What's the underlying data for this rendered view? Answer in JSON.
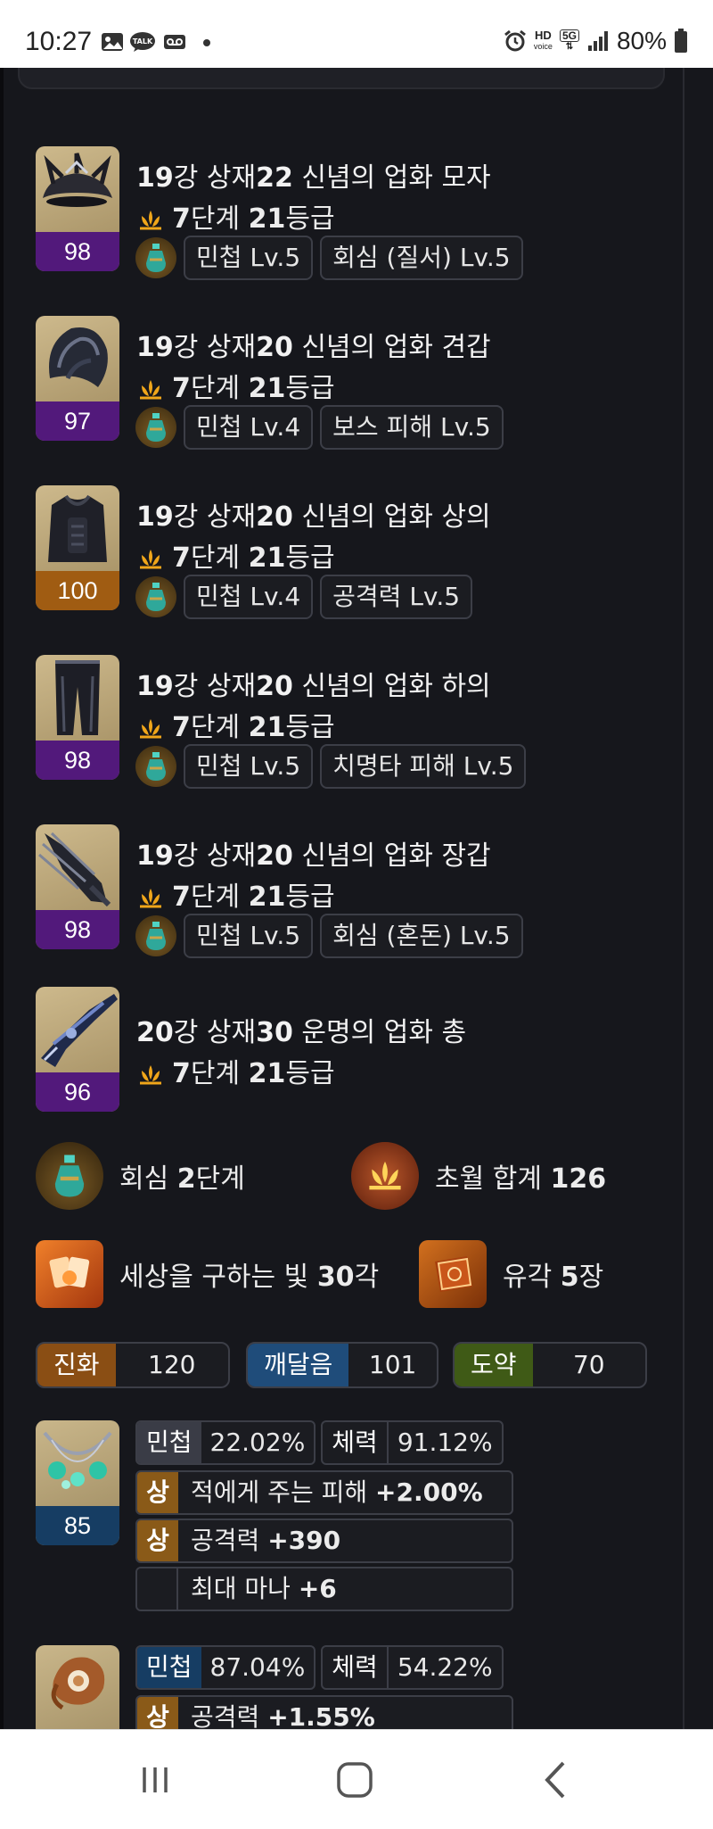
{
  "status_bar": {
    "time": "10:27",
    "notification_icons": [
      "gallery-icon",
      "talk-icon",
      "voicemail-icon",
      "dot-icon"
    ],
    "hd_label": "HD",
    "voice_label": "voice",
    "network_label": "5G",
    "battery": "80%"
  },
  "equipment": [
    {
      "name_pre": "19",
      "name_mid": "강 상재",
      "name_num": "22",
      "name_post": " 신념의 업화 모자",
      "quality": "98",
      "quality_color": "#52197b",
      "tr_stage": "7",
      "tr_stage_label": "단계 ",
      "tr_grade": "21",
      "tr_grade_label": "등급",
      "elixirs": [
        "민첩 Lv.5",
        "회심 (질서) Lv.5"
      ],
      "icon": "helmet-icon"
    },
    {
      "name_pre": "19",
      "name_mid": "강 상재",
      "name_num": "20",
      "name_post": " 신념의 업화 견갑",
      "quality": "97",
      "quality_color": "#52197b",
      "tr_stage": "7",
      "tr_stage_label": "단계 ",
      "tr_grade": "21",
      "tr_grade_label": "등급",
      "elixirs": [
        "민첩 Lv.4",
        "보스 피해 Lv.5"
      ],
      "icon": "shoulder-icon"
    },
    {
      "name_pre": "19",
      "name_mid": "강 상재",
      "name_num": "20",
      "name_post": " 신념의 업화 상의",
      "quality": "100",
      "quality_color": "#a05c12",
      "tr_stage": "7",
      "tr_stage_label": "단계 ",
      "tr_grade": "21",
      "tr_grade_label": "등급",
      "elixirs": [
        "민첩 Lv.4",
        "공격력 Lv.5"
      ],
      "icon": "chest-icon"
    },
    {
      "name_pre": "19",
      "name_mid": "강 상재",
      "name_num": "20",
      "name_post": " 신념의 업화 하의",
      "quality": "98",
      "quality_color": "#52197b",
      "tr_stage": "7",
      "tr_stage_label": "단계 ",
      "tr_grade": "21",
      "tr_grade_label": "등급",
      "elixirs": [
        "민첩 Lv.5",
        "치명타 피해 Lv.5"
      ],
      "icon": "pants-icon"
    },
    {
      "name_pre": "19",
      "name_mid": "강 상재",
      "name_num": "20",
      "name_post": " 신념의 업화 장갑",
      "quality": "98",
      "quality_color": "#52197b",
      "tr_stage": "7",
      "tr_stage_label": "단계 ",
      "tr_grade": "21",
      "tr_grade_label": "등급",
      "elixirs": [
        "민첩 Lv.5",
        "회심 (혼돈) Lv.5"
      ],
      "icon": "gloves-icon"
    },
    {
      "name_pre": "20",
      "name_mid": "강 상재",
      "name_num": "30",
      "name_post": " 운명의 업화 총",
      "quality": "96",
      "quality_color": "#52197b",
      "tr_stage": "7",
      "tr_stage_label": "단계 ",
      "tr_grade": "21",
      "tr_grade_label": "등급",
      "elixirs": [],
      "icon": "gun-icon"
    }
  ],
  "summary": {
    "elixir_label": "회심 ",
    "elixir_num": "2",
    "elixir_suffix": "단계",
    "transcend_label": "초월 합계 ",
    "transcend_total": "126",
    "light_label": "세상을 구하는 빛 ",
    "light_num": "30",
    "light_suffix": "각",
    "relic_label": "유각 ",
    "relic_num": "5",
    "relic_suffix": "장"
  },
  "ark_passive": [
    {
      "name": "진화",
      "value": "120",
      "color": "#8a4e14"
    },
    {
      "name": "깨달음",
      "value": "101",
      "color": "#1f4c7a"
    },
    {
      "name": "도약",
      "value": "70",
      "color": "#3f5a16"
    }
  ],
  "accessories": [
    {
      "quality": "85",
      "stat1_label": "민첩",
      "stat1_value": "22.02%",
      "stat2_label": "체력",
      "stat2_value": "91.12%",
      "lines": [
        {
          "grade": "상",
          "text": "적에게 주는 피해 ",
          "value": "+2.00%"
        },
        {
          "grade": "상",
          "text": "공격력 ",
          "value": "+390"
        },
        {
          "grade": "",
          "text": "최대 마나 ",
          "value": "+6"
        }
      ]
    },
    {
      "quality": "",
      "stat1_label": "민첩",
      "stat1_value": "87.04%",
      "stat2_label": "체력",
      "stat2_value": "54.22%",
      "lines": [
        {
          "grade": "상",
          "text": "공격력 ",
          "value": "+1.55%"
        }
      ]
    }
  ],
  "nav": {
    "recent": "recent-apps-icon",
    "home": "home-icon",
    "back": "back-icon"
  }
}
